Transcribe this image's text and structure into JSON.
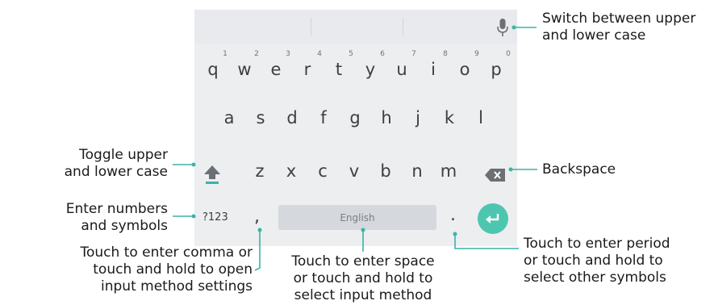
{
  "keyboard": {
    "row1": [
      {
        "key": "q",
        "hint": "1"
      },
      {
        "key": "w",
        "hint": "2"
      },
      {
        "key": "e",
        "hint": "3"
      },
      {
        "key": "r",
        "hint": "4"
      },
      {
        "key": "t",
        "hint": "5"
      },
      {
        "key": "y",
        "hint": "6"
      },
      {
        "key": "u",
        "hint": "7"
      },
      {
        "key": "i",
        "hint": "8"
      },
      {
        "key": "o",
        "hint": "9"
      },
      {
        "key": "p",
        "hint": "0"
      }
    ],
    "row2": [
      "a",
      "s",
      "d",
      "f",
      "g",
      "h",
      "j",
      "k",
      "l"
    ],
    "row3": [
      "z",
      "x",
      "c",
      "v",
      "b",
      "n",
      "m"
    ],
    "symbols_label": "?123",
    "comma": ",",
    "space_label": "English",
    "period": ".",
    "icons": {
      "mic": "microphone-icon",
      "shift": "shift-arrow-icon",
      "backspace": "backspace-icon",
      "enter": "enter-arrow-icon"
    },
    "colors": {
      "accent": "#3bb3a8",
      "enter_button": "#4dc6b0",
      "keyboard_bg": "#eceef0"
    }
  },
  "callouts": {
    "mic": [
      "Switch between upper",
      "and lower case"
    ],
    "shift": [
      "Toggle upper",
      "and lower case"
    ],
    "backspace": [
      "Backspace"
    ],
    "symbols": [
      "Enter numbers",
      "and symbols"
    ],
    "comma": [
      "Touch to enter comma or",
      "touch and hold to open",
      "input method settings"
    ],
    "space": [
      "Touch to enter space",
      "or touch and hold to",
      "select input method"
    ],
    "period": [
      "Touch to enter period",
      "or touch and hold to",
      "select other symbols"
    ]
  }
}
